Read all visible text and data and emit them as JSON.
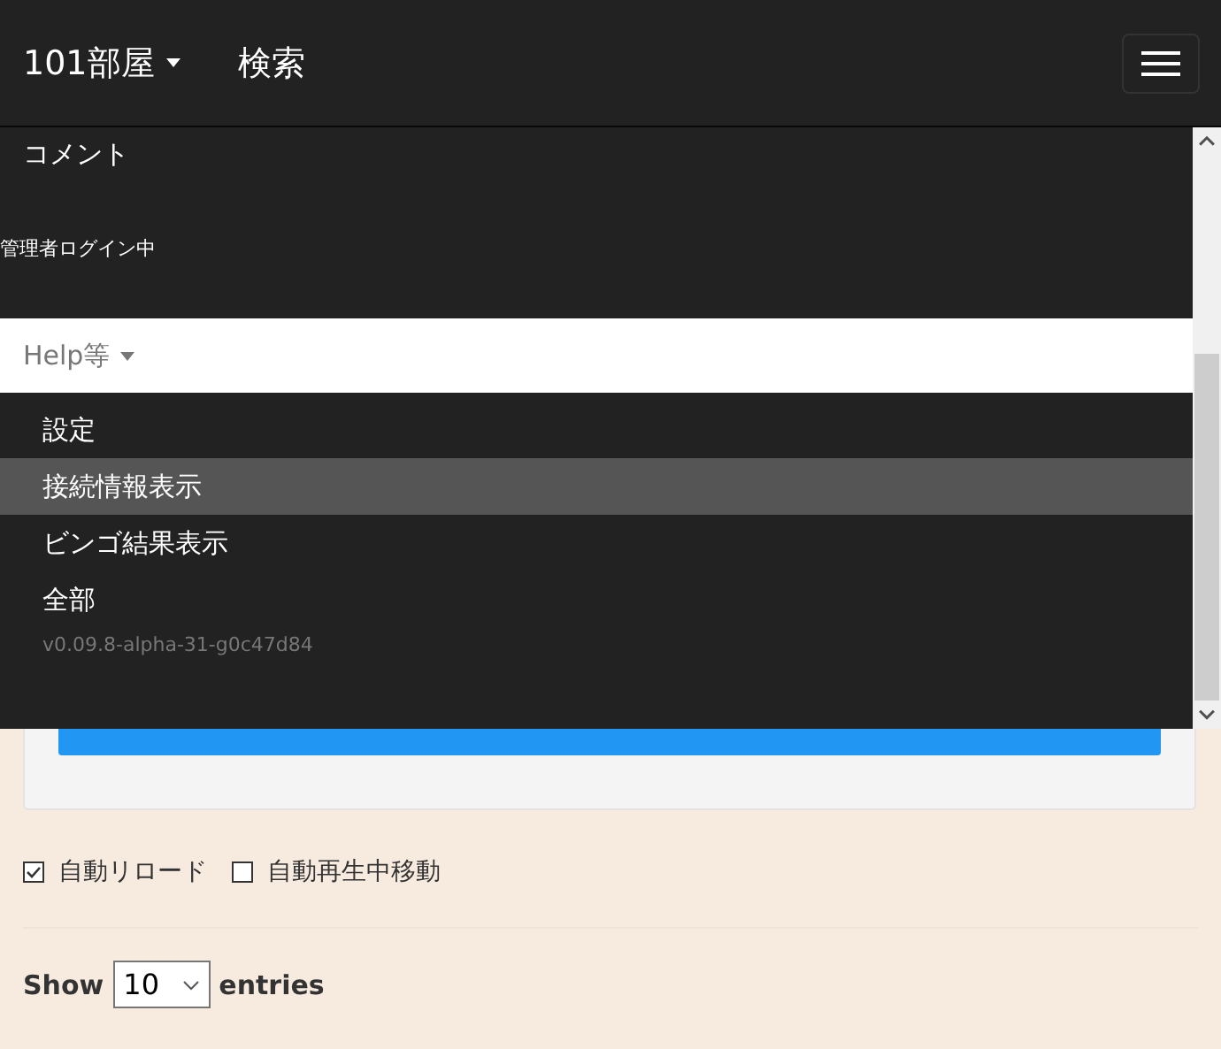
{
  "navbar": {
    "brand": "101部屋",
    "search_link": "検索"
  },
  "menu": {
    "items": [
      {
        "label": "コメント"
      }
    ],
    "status": "管理者ログイン中",
    "dropdown": {
      "label": "Help等",
      "expanded": true,
      "items": [
        {
          "label": "設定",
          "selected": false
        },
        {
          "label": "接続情報表示",
          "selected": true
        },
        {
          "label": "ビンゴ結果表示",
          "selected": false
        },
        {
          "label": "全部",
          "selected": false
        }
      ],
      "version": "v0.09.8-alpha-31-g0c47d84"
    }
  },
  "options": [
    {
      "label": "自動リロード",
      "checked": true
    },
    {
      "label": "自動再生中移動",
      "checked": false
    }
  ],
  "table_length": {
    "prefix": "Show",
    "value": "10",
    "suffix": "entries"
  }
}
